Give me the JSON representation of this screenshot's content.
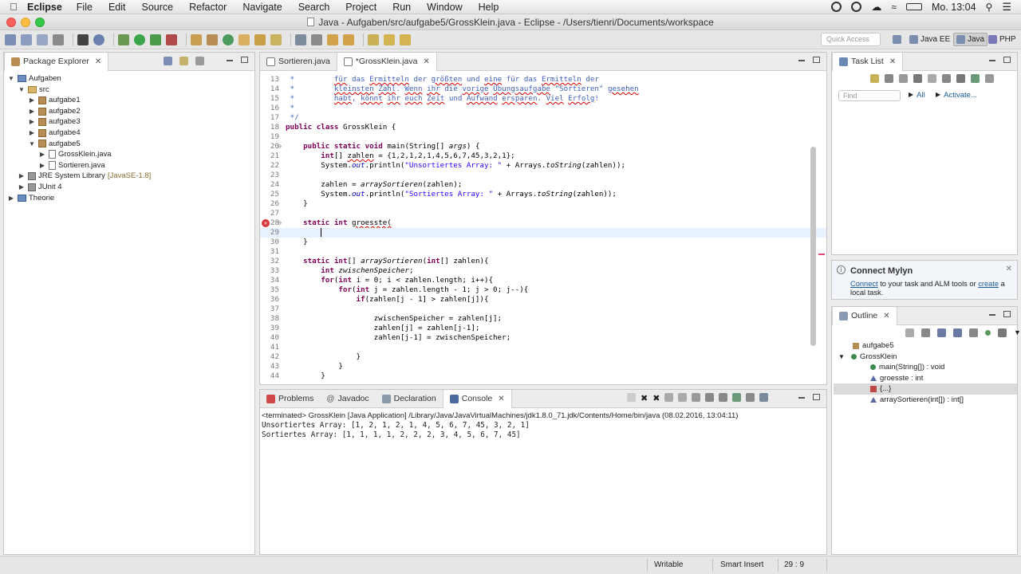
{
  "menubar": {
    "app": "Eclipse",
    "items": [
      "File",
      "Edit",
      "Source",
      "Refactor",
      "Navigate",
      "Search",
      "Project",
      "Run",
      "Window",
      "Help"
    ],
    "clock": "Mo. 13:04"
  },
  "window": {
    "title": "Java - Aufgaben/src/aufgabe5/GrossKlein.java - Eclipse - /Users/tienri/Documents/workspace"
  },
  "toolbar": {
    "quick_access_placeholder": "Quick Access",
    "perspectives": [
      "Java EE",
      "Java",
      "PHP"
    ]
  },
  "package_explorer": {
    "title": "Package Explorer",
    "tree": [
      {
        "label": "Aufgaben",
        "kind": "project",
        "level": 0,
        "expanded": true
      },
      {
        "label": "src",
        "kind": "src",
        "level": 1,
        "expanded": true
      },
      {
        "label": "aufgabe1",
        "kind": "package",
        "level": 2,
        "expanded": false
      },
      {
        "label": "aufgabe2",
        "kind": "package",
        "level": 2,
        "expanded": false
      },
      {
        "label": "aufgabe3",
        "kind": "package",
        "level": 2,
        "expanded": false
      },
      {
        "label": "aufgabe4",
        "kind": "package",
        "level": 2,
        "expanded": false
      },
      {
        "label": "aufgabe5",
        "kind": "package",
        "level": 2,
        "expanded": true
      },
      {
        "label": "GrossKlein.java",
        "kind": "file",
        "level": 3,
        "expanded": false
      },
      {
        "label": "Sortieren.java",
        "kind": "file",
        "level": 3,
        "expanded": false
      },
      {
        "label": "JRE System Library",
        "suffix": "[JavaSE-1.8]",
        "kind": "library",
        "level": 1,
        "expanded": false
      },
      {
        "label": "JUnit 4",
        "kind": "library",
        "level": 1,
        "expanded": false
      },
      {
        "label": "Theorie",
        "kind": "project",
        "level": 0,
        "expanded": false
      }
    ]
  },
  "editor": {
    "tabs": [
      {
        "label": "Sortieren.java",
        "active": false
      },
      {
        "label": "*GrossKlein.java",
        "active": true
      }
    ],
    "cursor_line": "29",
    "error_line": "28",
    "lines": [
      {
        "n": "13",
        "html": "<span class=\"cm\"> *         <span class=\"err\">für</span> das <span class=\"err\">Ermitteln</span> der <span class=\"err\">größten</span> und <span class=\"err\">eine</span> für das <span class=\"err\">Ermitteln</span> der</span>"
      },
      {
        "n": "14",
        "html": "<span class=\"cm\"> *         <span class=\"err\">kleinsten</span> <span class=\"err\">Zahl</span>. <span class=\"err\">Wenn</span> <span class=\"err\">ihr</span> die <span class=\"err\">vorige</span> <span class=\"err\">Übungsaufgabe</span> \"Sortieren\" <span class=\"err\">gesehen</span></span>"
      },
      {
        "n": "15",
        "html": "<span class=\"cm\"> *         <span class=\"err\">habt</span>, <span class=\"err\">könnt</span> <span class=\"err\">ihr</span> <span class=\"err\">euch</span> <span class=\"err\">Zeit</span> und <span class=\"err\">Aufwand</span> <span class=\"err\">ersparen</span>. <span class=\"err\">Viel</span> <span class=\"err\">Erfolg</span>!</span>"
      },
      {
        "n": "16",
        "html": "<span class=\"cm\"> *</span>"
      },
      {
        "n": "17",
        "html": "<span class=\"cm\"> */</span>"
      },
      {
        "n": "18",
        "html": "<span class=\"kw\">public</span> <span class=\"kw\">class</span> GrossKlein {"
      },
      {
        "n": "19",
        "html": ""
      },
      {
        "n": "20",
        "html": "    <span class=\"kw\">public</span> <span class=\"kw\">static</span> <span class=\"kw\">void</span> main(String[] <span class=\"it\">args</span>) {"
      },
      {
        "n": "21",
        "html": "        <span class=\"kw\">int</span>[] <span class=\"err\">zahlen</span> = {1,2,1,2,1,4,5,6,7,45,3,2,1};"
      },
      {
        "n": "22",
        "html": "        System.<span class=\"fld\">out</span>.println(<span class=\"str\">\"Unsortiertes Array: \"</span> + Arrays.<span class=\"it\">toString</span>(zahlen));"
      },
      {
        "n": "23",
        "html": ""
      },
      {
        "n": "24",
        "html": "        zahlen = <span class=\"it\">arraySortieren</span>(zahlen);"
      },
      {
        "n": "25",
        "html": "        System.<span class=\"fld\">out</span>.println(<span class=\"str\">\"Sortiertes Array: \"</span> + Arrays.<span class=\"it\">toString</span>(zahlen));"
      },
      {
        "n": "26",
        "html": "    }"
      },
      {
        "n": "27",
        "html": ""
      },
      {
        "n": "28",
        "html": "    <span class=\"kw\">static</span> <span class=\"kw\">int</span> <span class=\"err\">groesste(</span>"
      },
      {
        "n": "29",
        "html": ""
      },
      {
        "n": "30",
        "html": "    }"
      },
      {
        "n": "31",
        "html": ""
      },
      {
        "n": "32",
        "html": "    <span class=\"kw\">static</span> <span class=\"kw\">int</span>[] <span class=\"it\">arraySortieren</span>(<span class=\"kw\">int</span>[] zahlen){"
      },
      {
        "n": "33",
        "html": "        <span class=\"kw\">int</span> <span class=\"it\">zwischenSpeicher</span>;"
      },
      {
        "n": "34",
        "html": "        <span class=\"kw\">for</span>(<span class=\"kw\">int</span> i = 0; i &lt; zahlen.length; i++){"
      },
      {
        "n": "35",
        "html": "            <span class=\"kw\">for</span>(<span class=\"kw\">int</span> j = zahlen.length - 1; j &gt; 0; j--){"
      },
      {
        "n": "36",
        "html": "                <span class=\"kw\">if</span>(zahlen[j - 1] &gt; zahlen[j]){"
      },
      {
        "n": "37",
        "html": ""
      },
      {
        "n": "38",
        "html": "                    zwischenSpeicher = zahlen[j];"
      },
      {
        "n": "39",
        "html": "                    zahlen[j] = zahlen[j-1];"
      },
      {
        "n": "40",
        "html": "                    zahlen[j-1] = zwischenSpeicher;"
      },
      {
        "n": "41",
        "html": ""
      },
      {
        "n": "42",
        "html": "                }"
      },
      {
        "n": "43",
        "html": "            }"
      },
      {
        "n": "44",
        "html": "        }"
      }
    ]
  },
  "bottom_panel": {
    "tabs": [
      "Problems",
      "Javadoc",
      "Declaration",
      "Console"
    ],
    "active_tab": "Console",
    "terminated": "<terminated> GrossKlein [Java Application] /Library/Java/JavaVirtualMachines/jdk1.8.0_71.jdk/Contents/Home/bin/java (08.02.2016, 13:04:11)",
    "output_line1": "Unsortiertes Array: [1, 2, 1, 2, 1, 4, 5, 6, 7, 45, 3, 2, 1]",
    "output_line2": "Sortiertes Array: [1, 1, 1, 1, 2, 2, 2, 3, 4, 5, 6, 7, 45]"
  },
  "task_list": {
    "title": "Task List",
    "find_placeholder": "Find",
    "all_label": "All",
    "activate_label": "Activate..."
  },
  "mylyn": {
    "title": "Connect Mylyn",
    "link_connect": "Connect",
    "text_mid": " to your task and ALM tools or ",
    "link_create": "create",
    "text_end": " a local task."
  },
  "outline": {
    "title": "Outline",
    "items": [
      {
        "label": "aufgabe5",
        "level": 0
      },
      {
        "label": "GrossKlein",
        "level": 0
      },
      {
        "label": "main(String[]) : void",
        "level": 1
      },
      {
        "label": "groesste : int",
        "level": 1
      },
      {
        "label": "{...}",
        "level": 1
      },
      {
        "label": "arraySortieren(int[]) : int[]",
        "level": 1
      }
    ]
  },
  "statusbar": {
    "writable": "Writable",
    "insert_mode": "Smart Insert",
    "position": "29 : 9"
  }
}
